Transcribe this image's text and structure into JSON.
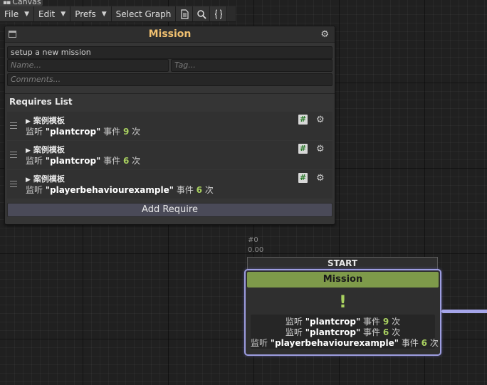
{
  "window": {
    "title": "Canvas"
  },
  "toolbar": {
    "menus": [
      "File",
      "Edit",
      "Prefs"
    ],
    "select_graph": "Select Graph",
    "icons": [
      "document-icon",
      "search-icon",
      "braces-icon"
    ]
  },
  "inspector": {
    "title": "Mission",
    "description": "setup a new mission",
    "name_placeholder": "Name...",
    "tag_placeholder": "Tag...",
    "comments_placeholder": "Comments...",
    "requires_title": "Requires List",
    "requires": [
      {
        "name": "案例模板",
        "prefix": "监听",
        "target": "\"plantcrop\"",
        "event": "事件",
        "count": "9",
        "unit": "次"
      },
      {
        "name": "案例模板",
        "prefix": "监听",
        "target": "\"plantcrop\"",
        "event": "事件",
        "count": "6",
        "unit": "次"
      },
      {
        "name": "案例模板",
        "prefix": "监听",
        "target": "\"playerbehaviourexample\"",
        "event": "事件",
        "count": "6",
        "unit": "次"
      }
    ],
    "add_require": "Add Require",
    "hash_glyph": "#"
  },
  "node": {
    "id": "#0",
    "time": "0.00",
    "start_label": "START",
    "title": "Mission",
    "mark": "!",
    "lines": [
      {
        "prefix": "监听",
        "target": "\"plantcrop\"",
        "event": "事件",
        "count": "9",
        "unit": "次"
      },
      {
        "prefix": "监听",
        "target": "\"plantcrop\"",
        "event": "事件",
        "count": "6",
        "unit": "次"
      },
      {
        "prefix": "监听",
        "target": "\"playerbehaviourexample\"",
        "event": "事件",
        "count": "6",
        "unit": "次"
      }
    ]
  },
  "colors": {
    "title_accent": "#f0c070",
    "node_header": "#7e9a4a",
    "node_border": "#9d9de0",
    "count_green": "#a8d060"
  }
}
